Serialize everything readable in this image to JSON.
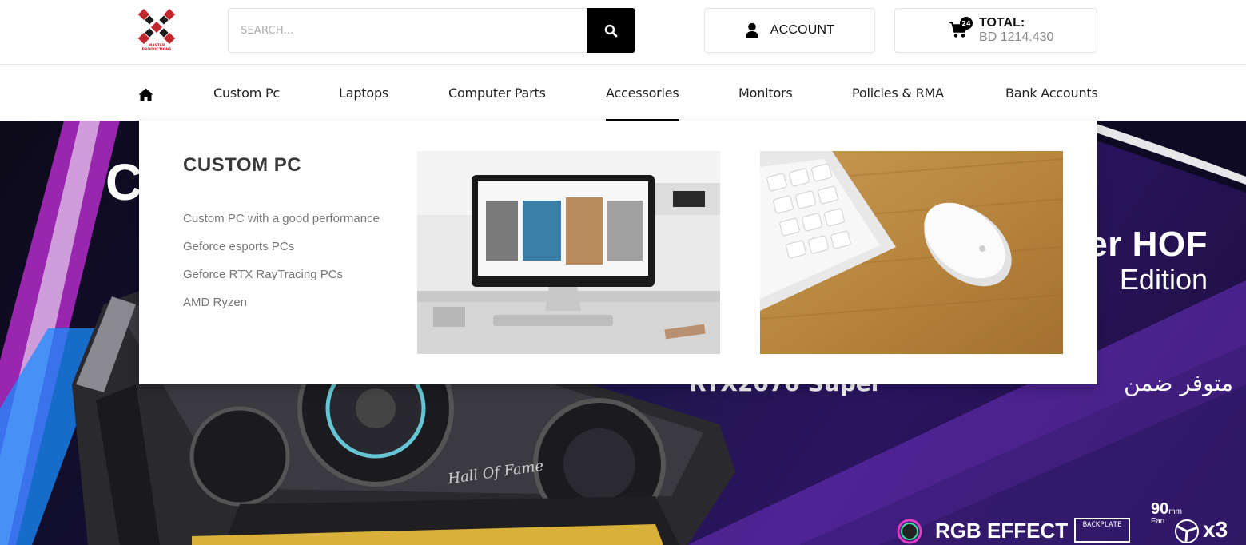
{
  "header": {
    "logo_text": "MASTER PRODUCTIONS",
    "search": {
      "placeholder": "SEARCH..."
    },
    "account_label": "ACCOUNT",
    "cart": {
      "badge_count": "24",
      "total_label": "TOTAL:",
      "total_value": "BD 1214.430"
    }
  },
  "nav": {
    "items": [
      {
        "label": "Custom Pc"
      },
      {
        "label": "Laptops"
      },
      {
        "label": "Computer Parts"
      },
      {
        "label": "Accessories",
        "active": true
      },
      {
        "label": "Monitors"
      },
      {
        "label": "Policies & RMA"
      },
      {
        "label": "Bank Accounts"
      }
    ]
  },
  "mega_menu": {
    "title": "CUSTOM PC",
    "links": [
      {
        "label": "Custom PC with a good performance"
      },
      {
        "label": "Geforce esports PCs"
      },
      {
        "label": "Geforce RTX RayTracing PCs"
      },
      {
        "label": "AMD Ryzen"
      }
    ],
    "images": [
      {
        "name": "monitor-photo"
      },
      {
        "name": "keyboard-mouse-photo"
      }
    ]
  },
  "hero": {
    "heading_partial": "C",
    "title_line1": "er HOF",
    "title_line2": "Edition",
    "arabic_text": "متوفر ضمن",
    "arabic_hidden": "RTX2070 Super",
    "gpu_label": "Hall Of Fame",
    "rgb_label": "RGB EFFECT",
    "backplate_label": "BACKPLATE",
    "fan_size": "90",
    "fan_unit": "mm",
    "fan_label": "Fan",
    "fan_count": "x3"
  },
  "colors": {
    "accent": "#000000",
    "logo_red": "#c0262e",
    "hero_purple": "#2b1460",
    "link_gray": "#777777"
  }
}
